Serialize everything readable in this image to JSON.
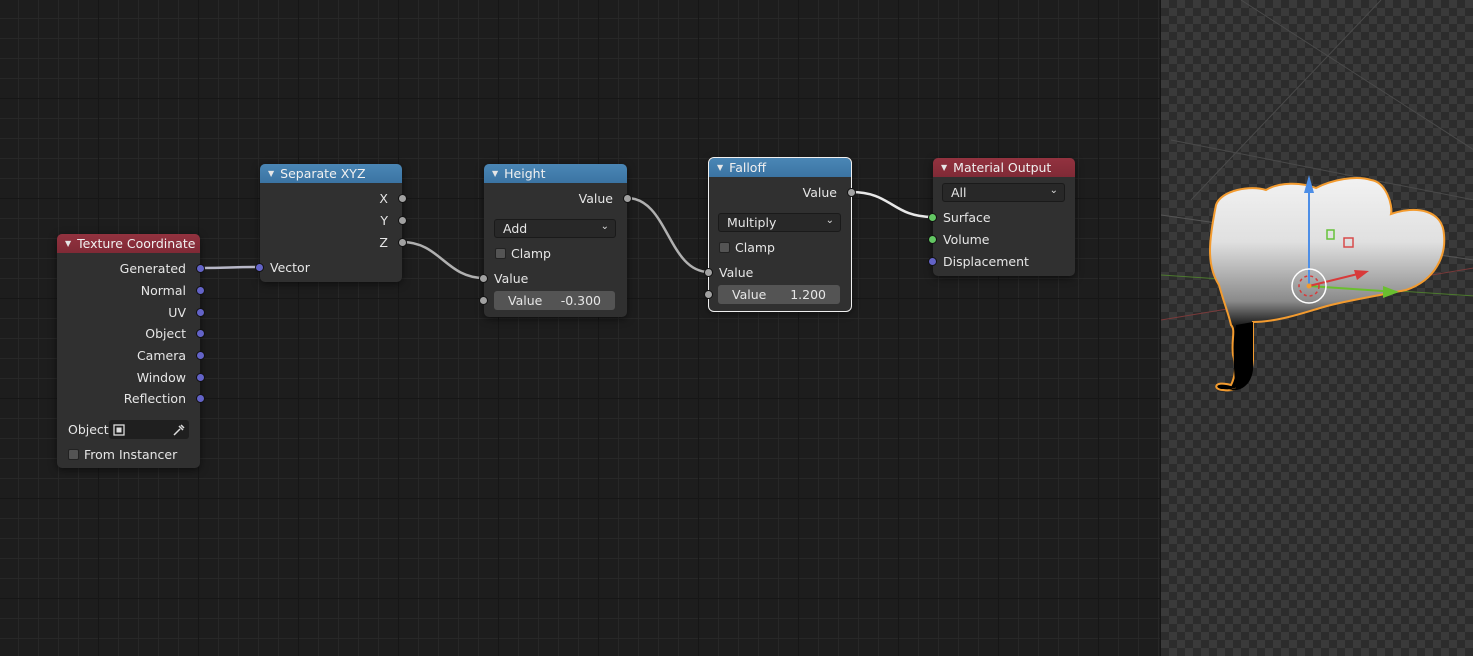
{
  "node_editor": {
    "nodes": {
      "texture_coordinate": {
        "title": "Texture Coordinate",
        "outputs": [
          "Generated",
          "Normal",
          "UV",
          "Object",
          "Camera",
          "Window",
          "Reflection"
        ],
        "object_label": "Object:",
        "from_instancer_label": "From Instancer",
        "from_instancer_checked": false
      },
      "separate_xyz": {
        "title": "Separate XYZ",
        "outputs": [
          "X",
          "Y",
          "Z"
        ],
        "input": "Vector"
      },
      "height": {
        "title": "Height",
        "output": "Value",
        "operation": "Add",
        "clamp_label": "Clamp",
        "clamp_checked": false,
        "input_socket_label": "Value",
        "value_field_label": "Value",
        "value_field_value": "-0.300"
      },
      "falloff": {
        "title": "Falloff",
        "output": "Value",
        "operation": "Multiply",
        "clamp_label": "Clamp",
        "clamp_checked": false,
        "input_socket_label": "Value",
        "value_field_label": "Value",
        "value_field_value": "1.200"
      },
      "material_output": {
        "title": "Material Output",
        "target": "All",
        "inputs": [
          "Surface",
          "Volume",
          "Displacement"
        ]
      }
    }
  },
  "colors": {
    "header_red": "#8a2f3b",
    "header_blue": "#3f79a8",
    "socket_vector": "#6363c7",
    "socket_float": "#a1a1a1",
    "socket_shader": "#63c763",
    "selection_outline": "#f0a030"
  },
  "icons": {
    "collapse": "triangle-down",
    "dropdown": "chevron-down",
    "object": "object-square",
    "eyedropper": "eyedropper"
  }
}
